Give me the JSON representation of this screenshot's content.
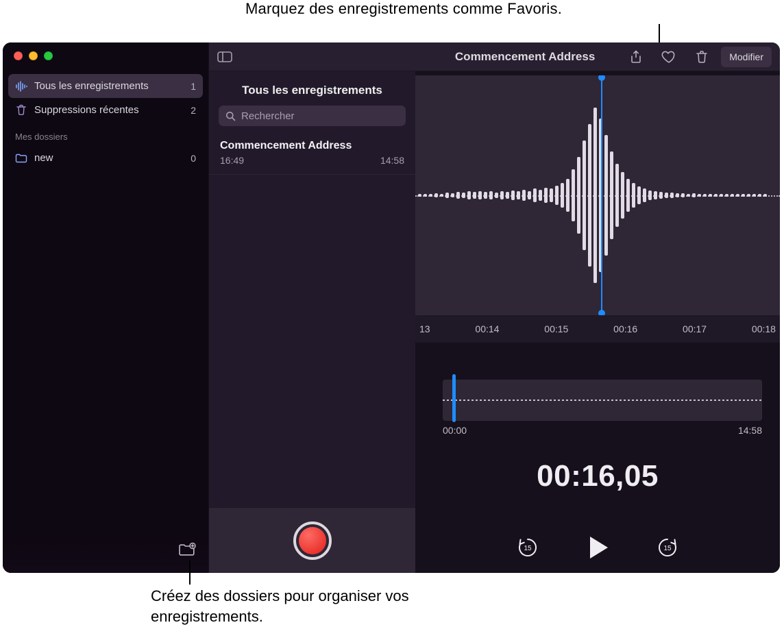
{
  "callouts": {
    "top": "Marquez des enregistrements comme Favoris.",
    "bottom": "Créez des dossiers pour organiser vos enregistrements."
  },
  "sidebar": {
    "items": [
      {
        "icon": "waveform-icon",
        "label": "Tous les enregistrements",
        "count": "1",
        "active": true
      },
      {
        "icon": "trash-icon",
        "label": "Suppressions récentes",
        "count": "2",
        "active": false
      }
    ],
    "folders_header": "Mes dossiers",
    "folders": [
      {
        "icon": "folder-icon",
        "label": "new",
        "count": "0"
      }
    ],
    "new_folder_label": "Nouveau dossier"
  },
  "midlist": {
    "title": "Tous les enregistrements",
    "search_placeholder": "Rechercher",
    "items": [
      {
        "name": "Commencement Address",
        "time": "16:49",
        "duration": "14:58"
      }
    ]
  },
  "toolbar": {
    "title": "Commencement Address",
    "share": "Partager",
    "favorite": "Favori",
    "delete": "Supprimer",
    "modify": "Modifier"
  },
  "timeline": {
    "ticks": [
      "13",
      "00:14",
      "00:15",
      "00:16",
      "00:17",
      "00:18"
    ]
  },
  "overview": {
    "start": "00:00",
    "end": "14:58"
  },
  "player": {
    "current_time": "00:16,05",
    "skip_back": "15",
    "skip_fwd": "15"
  }
}
